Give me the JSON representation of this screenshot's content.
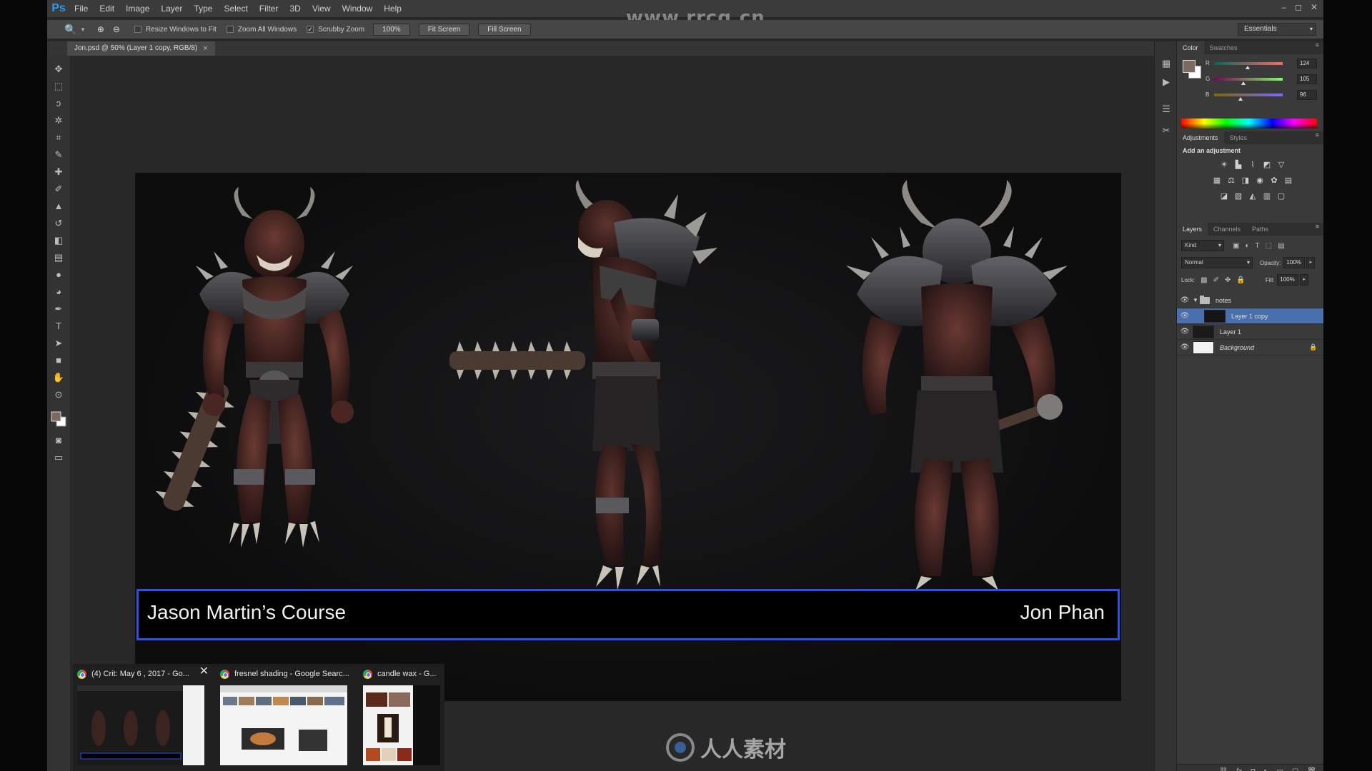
{
  "menubar": {
    "logo": "Ps",
    "items": [
      "File",
      "Edit",
      "Image",
      "Layer",
      "Type",
      "Select",
      "Filter",
      "3D",
      "View",
      "Window",
      "Help"
    ],
    "window_controls": [
      "–",
      "◻",
      "✕"
    ]
  },
  "watermark": {
    "url": "www.rrcg.cn",
    "bottom_text": "人人素材"
  },
  "options_bar": {
    "resize_windows_label": "Resize Windows to Fit",
    "resize_windows_checked": false,
    "zoom_all_label": "Zoom All Windows",
    "zoom_all_checked": false,
    "scrubby_zoom_label": "Scrubby Zoom",
    "scrubby_zoom_checked": true,
    "zoom_100_label": "100%",
    "fit_screen_label": "Fit Screen",
    "fill_screen_label": "Fill Screen",
    "workspace": "Essentials"
  },
  "document": {
    "tab_title": "Jon.psd @ 50% (Layer 1 copy, RGB/8)",
    "caption_left": "Jason Martin’s Course",
    "caption_right": "Jon Phan"
  },
  "tools": [
    "move-tool-icon",
    "marquee-tool-icon",
    "lasso-tool-icon",
    "magic-wand-icon",
    "crop-tool-icon",
    "eyedropper-icon",
    "healing-brush-icon",
    "brush-tool-icon",
    "clone-stamp-icon",
    "history-brush-icon",
    "eraser-icon",
    "gradient-icon",
    "blur-icon",
    "dodge-icon",
    "pen-tool-icon",
    "type-tool-icon",
    "path-select-icon",
    "shape-tool-icon",
    "hand-tool-icon",
    "zoom-tool-icon"
  ],
  "taskbar": {
    "thumbs": [
      {
        "title": "(4) Crit: May 6 , 2017 - Go..."
      },
      {
        "title": "fresnel shading - Google Searc..."
      },
      {
        "title": "candle wax - G..."
      }
    ]
  },
  "color_panel": {
    "tabs": [
      "Color",
      "Swatches"
    ],
    "r_label": "R",
    "g_label": "G",
    "b_label": "B",
    "r": "124",
    "g": "105",
    "b": "96",
    "fg_color": "#7c6960"
  },
  "adjustments_panel": {
    "tabs": [
      "Adjustments",
      "Styles"
    ],
    "title": "Add an adjustment"
  },
  "layers_panel": {
    "tabs": [
      "Layers",
      "Channels",
      "Paths"
    ],
    "kind_label": "Kind",
    "blend_mode": "Normal",
    "opacity_label": "Opacity:",
    "opacity": "100%",
    "lock_label": "Lock:",
    "fill_label": "Fill:",
    "fill": "100%",
    "layers": [
      {
        "name": "notes",
        "type": "group"
      },
      {
        "name": "Layer 1 copy",
        "type": "layer",
        "selected": true
      },
      {
        "name": "Layer 1",
        "type": "layer"
      },
      {
        "name": "Background",
        "type": "background",
        "locked": true
      }
    ]
  },
  "colors": {
    "caption_border": "#2952e6",
    "selected_layer": "#4a6fad",
    "ps_blue": "#2b9af3"
  }
}
